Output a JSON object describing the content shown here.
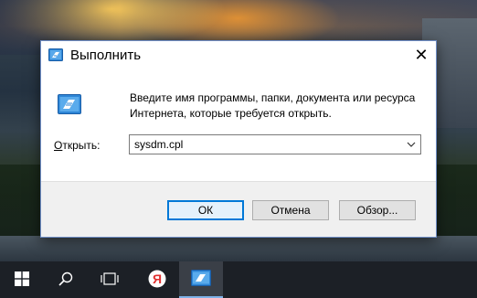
{
  "dialog": {
    "title": "Выполнить",
    "message": "Введите имя программы, папки, документа или ресурса Интернета, которые требуется открыть.",
    "open_label_u": "О",
    "open_label_rest": "ткрыть:",
    "input_value": "sysdm.cpl",
    "buttons": {
      "ok": "ОК",
      "cancel": "Отмена",
      "browse": "Обзор..."
    },
    "close_glyph": "✕",
    "icons": {
      "title": "run-icon",
      "body": "run-icon",
      "close": "close-icon",
      "dropdown": "chevron-down-icon"
    }
  },
  "taskbar": {
    "items": [
      "start-icon",
      "search-icon",
      "task-view-icon",
      "yandex-browser-icon",
      "run-icon"
    ],
    "yandex_letter": "Я",
    "colors": {
      "background": "#1c2026",
      "active_underline": "#7fb2e8",
      "yandex_red": "#e03030"
    }
  },
  "colors": {
    "accent": "#0078d7",
    "dialog_border": "#6f8ec7",
    "footer": "#f0f0f0"
  }
}
